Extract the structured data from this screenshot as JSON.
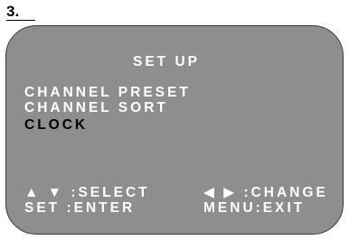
{
  "step": {
    "number": "3."
  },
  "screen": {
    "title": "SET UP",
    "items": [
      {
        "label": "CHANNEL PRESET",
        "selected": false
      },
      {
        "label": "CHANNEL SORT",
        "selected": false
      },
      {
        "label": "CLOCK",
        "selected": true
      }
    ],
    "hints": {
      "select": "▲ ▼ :SELECT",
      "change": "◀ ▶ :CHANGE",
      "enter": "SET :ENTER",
      "exit": "MENU:EXIT"
    }
  },
  "colors": {
    "screen_background": "#8e8e8e",
    "text_normal": "#ffffff",
    "text_selected": "#000000"
  }
}
